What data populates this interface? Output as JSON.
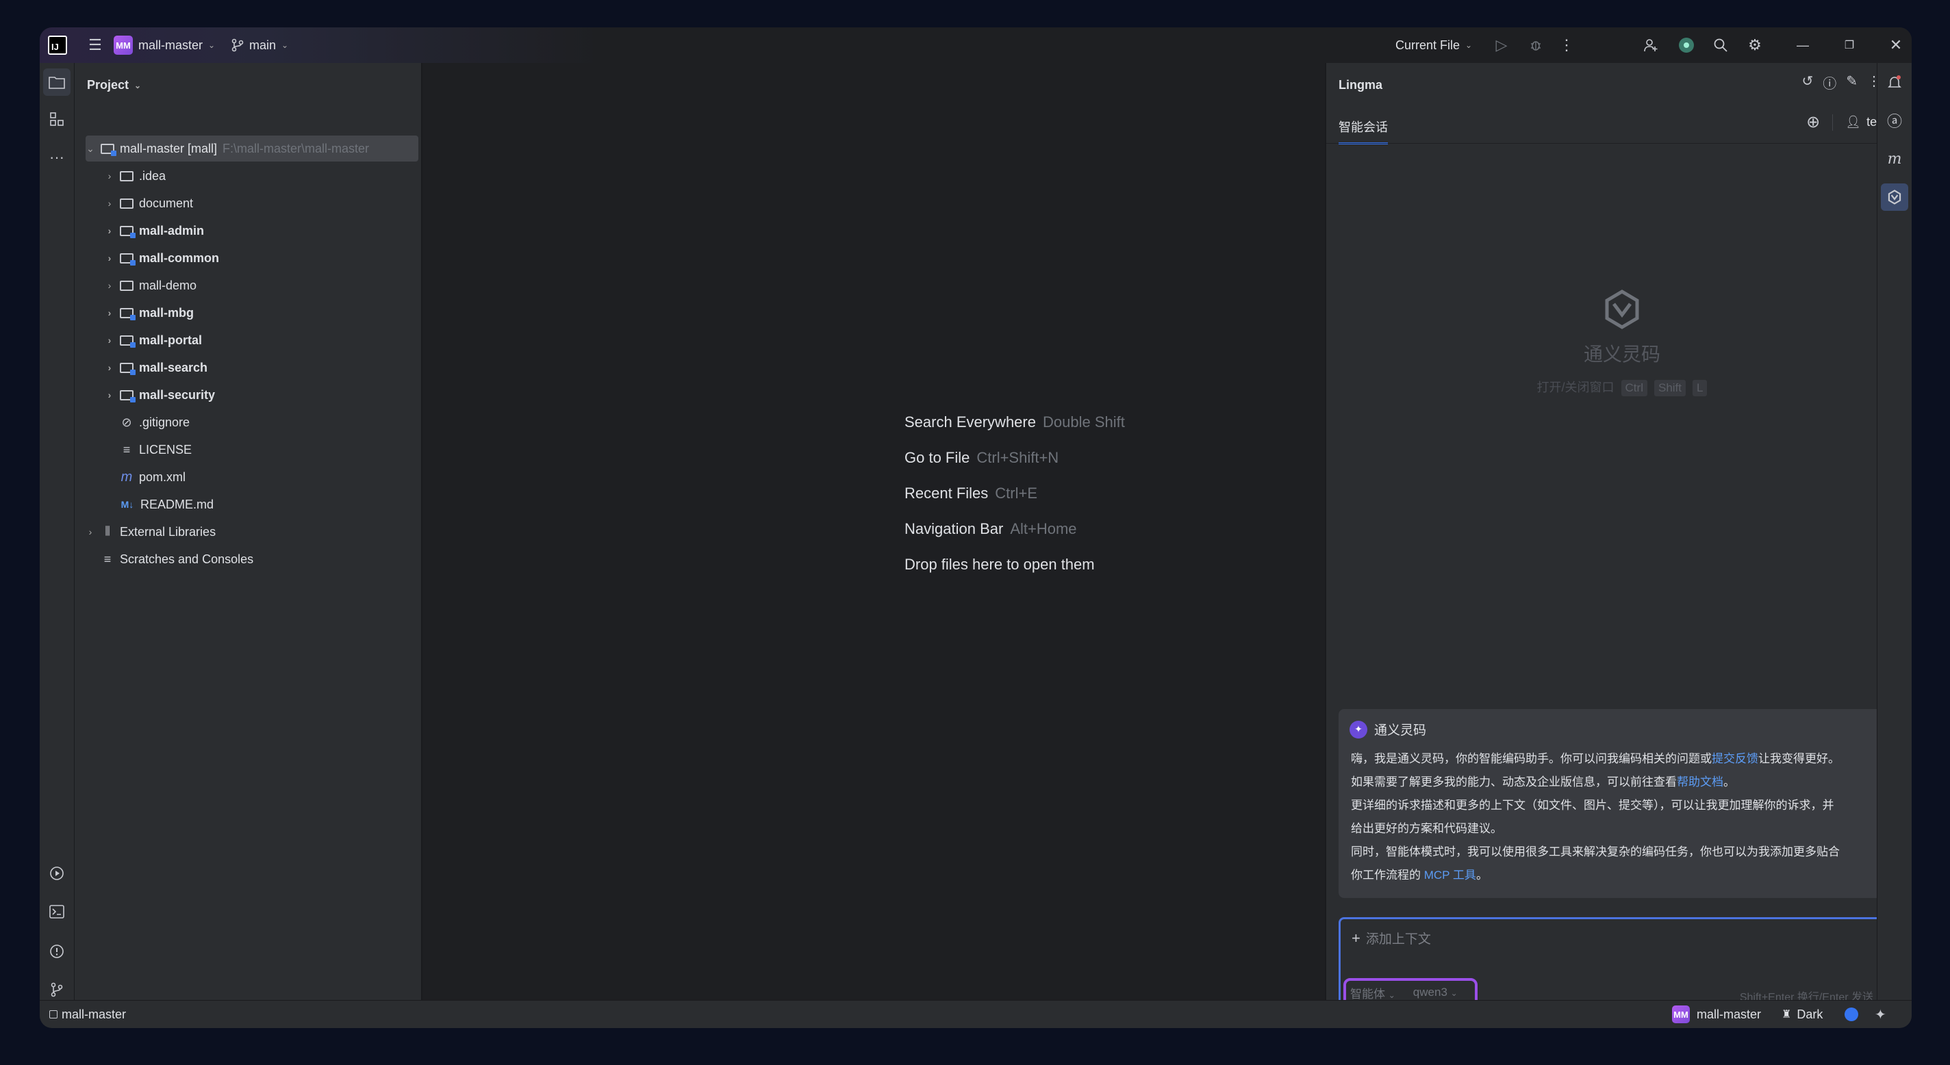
{
  "titlebar": {
    "logo_text": "IJ",
    "project_badge": "MM",
    "project_name": "mall-master",
    "branch": "main",
    "run_config": "Current File"
  },
  "project_panel": {
    "title": "Project",
    "items": [
      {
        "name": "mall-master [mall]",
        "path": "F:\\mall-master\\mall-master"
      },
      {
        "name": ".idea"
      },
      {
        "name": "document"
      },
      {
        "name": "mall-admin"
      },
      {
        "name": "mall-common"
      },
      {
        "name": "mall-demo"
      },
      {
        "name": "mall-mbg"
      },
      {
        "name": "mall-portal"
      },
      {
        "name": "mall-search"
      },
      {
        "name": "mall-security"
      },
      {
        "name": ".gitignore"
      },
      {
        "name": "LICENSE"
      },
      {
        "name": "pom.xml"
      },
      {
        "name": "README.md"
      },
      {
        "name": "External Libraries"
      },
      {
        "name": "Scratches and Consoles"
      }
    ]
  },
  "editor_hints": [
    {
      "label": "Search Everywhere",
      "key": "Double Shift"
    },
    {
      "label": "Go to File",
      "key": "Ctrl+Shift+N"
    },
    {
      "label": "Recent Files",
      "key": "Ctrl+E"
    },
    {
      "label": "Navigation Bar",
      "key": "Alt+Home"
    },
    {
      "label": "Drop files here to open them",
      "key": ""
    }
  ],
  "lingma": {
    "title": "Lingma",
    "tab": "智能会话",
    "user": "test",
    "center_title": "通义灵码",
    "toggle_label": "打开/关闭窗口",
    "keys": [
      "Ctrl",
      "Shift",
      "L"
    ],
    "message": {
      "sender": "通义灵码",
      "line1_a": "嗨，我是通义灵码，你的智能编码助手。你可以问我编码相关的问题或",
      "line1_link": "提交反馈",
      "line1_b": "让我变得更好。",
      "line2_a": "如果需要了解更多我的能力、动态及企业版信息，可以前往查看",
      "line2_link": "帮助文档",
      "line2_b": "。",
      "line3": "更详细的诉求描述和更多的上下文（如文件、图片、提交等），可以让我更加理解你的诉求，并",
      "line4": "给出更好的方案和代码建议。",
      "line5": "同时，智能体模式时，我可以使用很多工具来解决复杂的编码任务，你也可以为我添加更多贴合",
      "line6_a": "你工作流程的 ",
      "line6_link": "MCP 工具",
      "line6_b": "。"
    },
    "input": {
      "add_context": "添加上下文",
      "mode": "智能体",
      "model": "qwen3",
      "send_hint": "Shift+Enter 换行/Enter 发送"
    }
  },
  "statusbar": {
    "left_project": "mall-master",
    "badge": "MM",
    "project": "mall-master",
    "theme": "Dark"
  },
  "colors": {
    "accent": "#3574f0",
    "highlight_border": "#9a4fe8"
  }
}
